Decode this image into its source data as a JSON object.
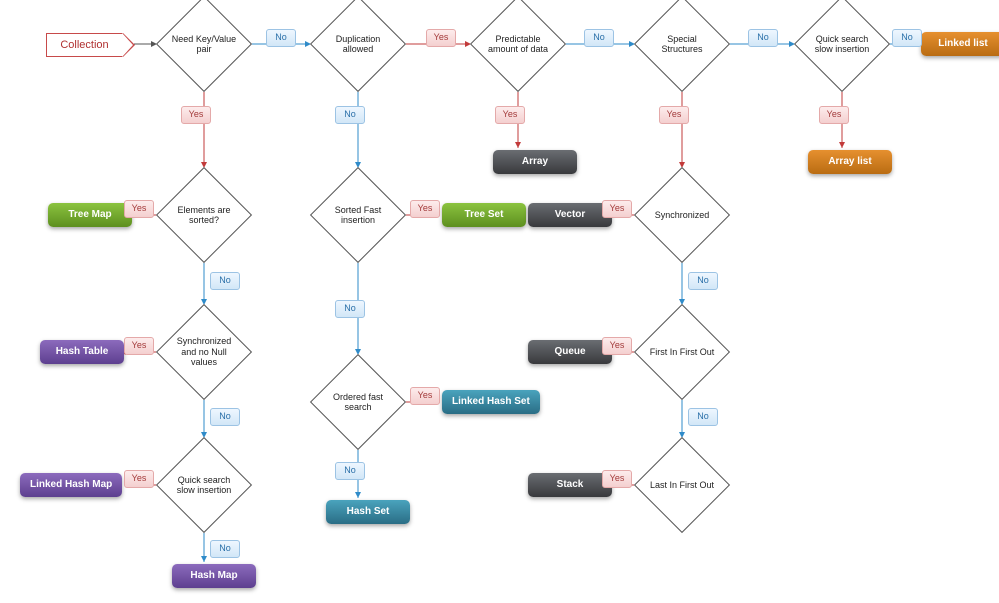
{
  "start": "Collection",
  "decisions": {
    "d_kv": "Need Key/Value pair",
    "d_dup": "Duplication allowed",
    "d_pred": "Predictable amount of data",
    "d_spec": "Special Structures",
    "d_qs1": "Quick search slow insertion",
    "d_sorted": "Elements are sorted?",
    "d_sortins": "Sorted Fast insertion",
    "d_sync2": "Synchronized and no Null values",
    "d_ordered": "Ordered fast search",
    "d_qs2": "Quick search slow insertion",
    "d_sync": "Synchronized",
    "d_fifo": "First In First Out",
    "d_lifo": "Last In First Out"
  },
  "terminals": {
    "t_treemap": "Tree Map",
    "t_hashtbl": "Hash Table",
    "t_lhmap": "Linked Hash Map",
    "t_hashmap": "Hash Map",
    "t_treeset": "Tree Set",
    "t_lhset": "Linked Hash Set",
    "t_hashset": "Hash Set",
    "t_array": "Array",
    "t_vector": "Vector",
    "t_queue": "Queue",
    "t_stack": "Stack",
    "t_linked": "Linked list",
    "t_arrlist": "Array list"
  },
  "labels": {
    "yes": "Yes",
    "no": "No"
  },
  "edges_description": [
    {
      "from": "start",
      "to": "d_kv"
    },
    {
      "from": "d_kv",
      "no": "d_dup",
      "yes": "d_sorted"
    },
    {
      "from": "d_dup",
      "yes": "d_pred",
      "no": "d_sortins"
    },
    {
      "from": "d_pred",
      "yes": "t_array",
      "no": "d_spec"
    },
    {
      "from": "d_spec",
      "yes": "d_sync",
      "no": "d_qs1"
    },
    {
      "from": "d_qs1",
      "yes": "t_arrlist",
      "no": "t_linked"
    },
    {
      "from": "d_sorted",
      "yes": "t_treemap",
      "no": "d_sync2"
    },
    {
      "from": "d_sync2",
      "yes": "t_hashtbl",
      "no": "d_qs2"
    },
    {
      "from": "d_qs2",
      "yes": "t_lhmap",
      "no": "t_hashmap"
    },
    {
      "from": "d_sortins",
      "yes": "t_treeset",
      "no": "d_ordered"
    },
    {
      "from": "d_ordered",
      "yes": "t_lhset",
      "no": "t_hashset"
    },
    {
      "from": "d_sync",
      "yes": "t_vector",
      "no": "d_fifo"
    },
    {
      "from": "d_fifo",
      "yes": "t_queue",
      "no": "d_lifo"
    },
    {
      "from": "d_lifo",
      "yes": "t_stack"
    }
  ],
  "colors": {
    "green": "#6ea82a",
    "purple": "#6b4f9e",
    "teal": "#34879f",
    "dark": "#4a4c4f",
    "orange": "#cc7a1a",
    "yes_edge": "#c23b3b",
    "no_edge": "#2f8bc9"
  }
}
